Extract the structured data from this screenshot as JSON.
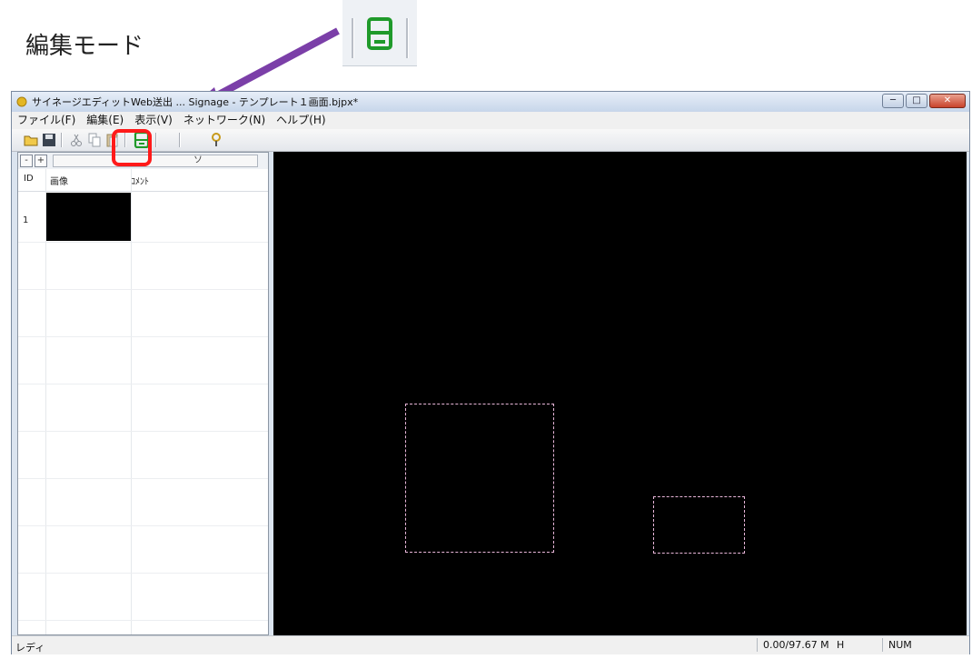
{
  "callout": {
    "label": "編集モード"
  },
  "window": {
    "title": "サイネージエディットWeb送出 ... Signage - テンプレート１画面.bjpx*",
    "buttons": {
      "minimize": "─",
      "maximize": "□",
      "close": "✕"
    }
  },
  "menu": {
    "items": [
      {
        "label": "ファイル(F)"
      },
      {
        "label": "編集(E)"
      },
      {
        "label": "表示(V)"
      },
      {
        "label": "ネットワーク(N)"
      },
      {
        "label": "ヘルプ(H)"
      }
    ]
  },
  "toolbar": {
    "icons": [
      "open-folder-icon",
      "save-icon",
      "cut-icon",
      "copy-icon",
      "paste-icon",
      "edit-mode-icon",
      "help-icon"
    ]
  },
  "panel": {
    "collapse_btn": "-",
    "expand_btn": "+",
    "tab_label": "ソ",
    "columns": {
      "id": "ID",
      "image": "画像",
      "comment": "ｺﾒﾝﾄ"
    },
    "rows": [
      {
        "id": "1",
        "comment": ""
      }
    ]
  },
  "status": {
    "ready": "レディ",
    "memory": "0.00/97.67 M",
    "mode": "H",
    "num": "NUM"
  },
  "colors": {
    "highlight": "#ff1a1a",
    "arrow": "#7b3fa8",
    "zone_outline": "#e8b6d9",
    "canvas": "#000000"
  }
}
